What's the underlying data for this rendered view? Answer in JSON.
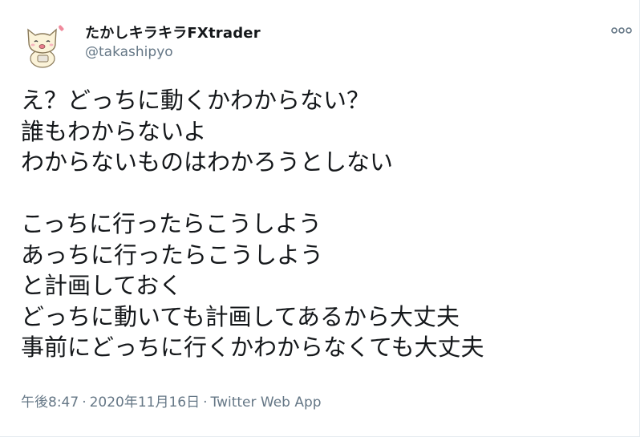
{
  "author": {
    "display_name": "たかしキラキラFXtrader",
    "username": "@takashipyo",
    "avatar_icon": "cat-avatar-icon"
  },
  "menu": {
    "more_icon": "more-dots-icon"
  },
  "tweet": {
    "text": "え？どっちに動くかわからない？\n誰もわからないよ\nわからないものはわかろうとしない\n\nこっちに行ったらこうしよう\nあっちに行ったらこうしよう\nと計画しておく\nどっちに動いても計画してあるから大丈夫\n事前にどっちに行くかわからなくても大丈夫"
  },
  "meta": {
    "time": "午後8:47",
    "separator": "·",
    "date": "2020年11月16日",
    "source": "Twitter Web App"
  },
  "colors": {
    "text_primary": "#14171a",
    "text_secondary": "#657786",
    "border": "#e6ecf0",
    "avatar_heart": "#f08a9c"
  }
}
